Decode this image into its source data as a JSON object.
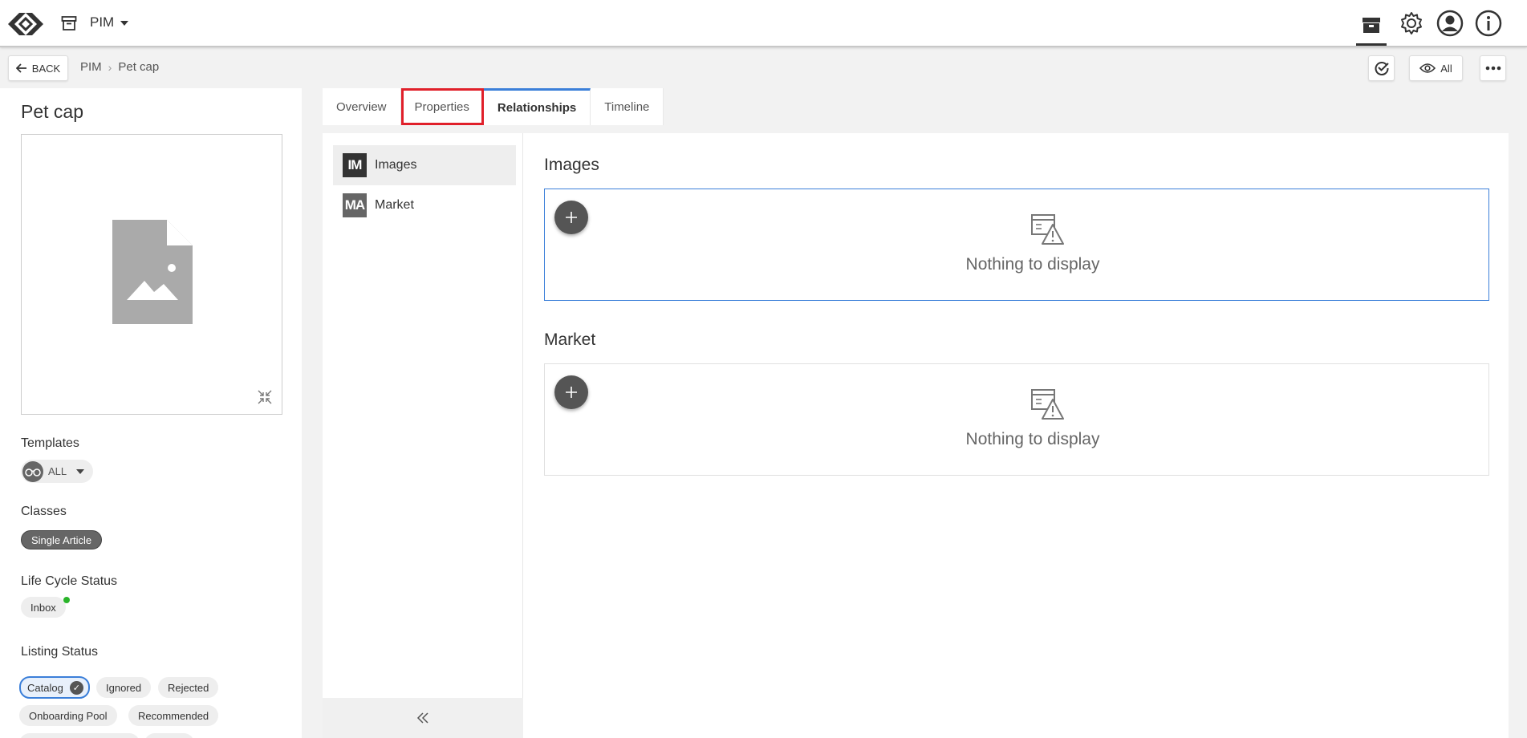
{
  "header": {
    "module": "PIM"
  },
  "toolbar": {
    "back_label": "BACK",
    "breadcrumb": [
      "PIM",
      "Pet cap"
    ],
    "view_label": "All"
  },
  "product": {
    "title": "Pet cap"
  },
  "sidebar": {
    "templates_label": "Templates",
    "templates_value": "ALL",
    "classes_label": "Classes",
    "classes": [
      "Single Article"
    ],
    "lifecycle_label": "Life Cycle Status",
    "lifecycle_value": "Inbox",
    "listing_label": "Listing Status",
    "listing": [
      "Catalog",
      "Ignored",
      "Rejected",
      "Onboarding Pool",
      "Recommended"
    ]
  },
  "tabs": [
    {
      "label": "Overview"
    },
    {
      "label": "Properties"
    },
    {
      "label": "Relationships"
    },
    {
      "label": "Timeline"
    }
  ],
  "nav": [
    {
      "badge": "IM",
      "label": "Images",
      "color": "#333333"
    },
    {
      "badge": "MA",
      "label": "Market",
      "color": "#666666"
    }
  ],
  "relationships": [
    {
      "title": "Images",
      "empty_text": "Nothing to display"
    },
    {
      "title": "Market",
      "empty_text": "Nothing to display"
    }
  ],
  "colors": {
    "accent": "#3b7fd9",
    "highlight": "#e0202a",
    "status_green": "#2ab42a"
  }
}
